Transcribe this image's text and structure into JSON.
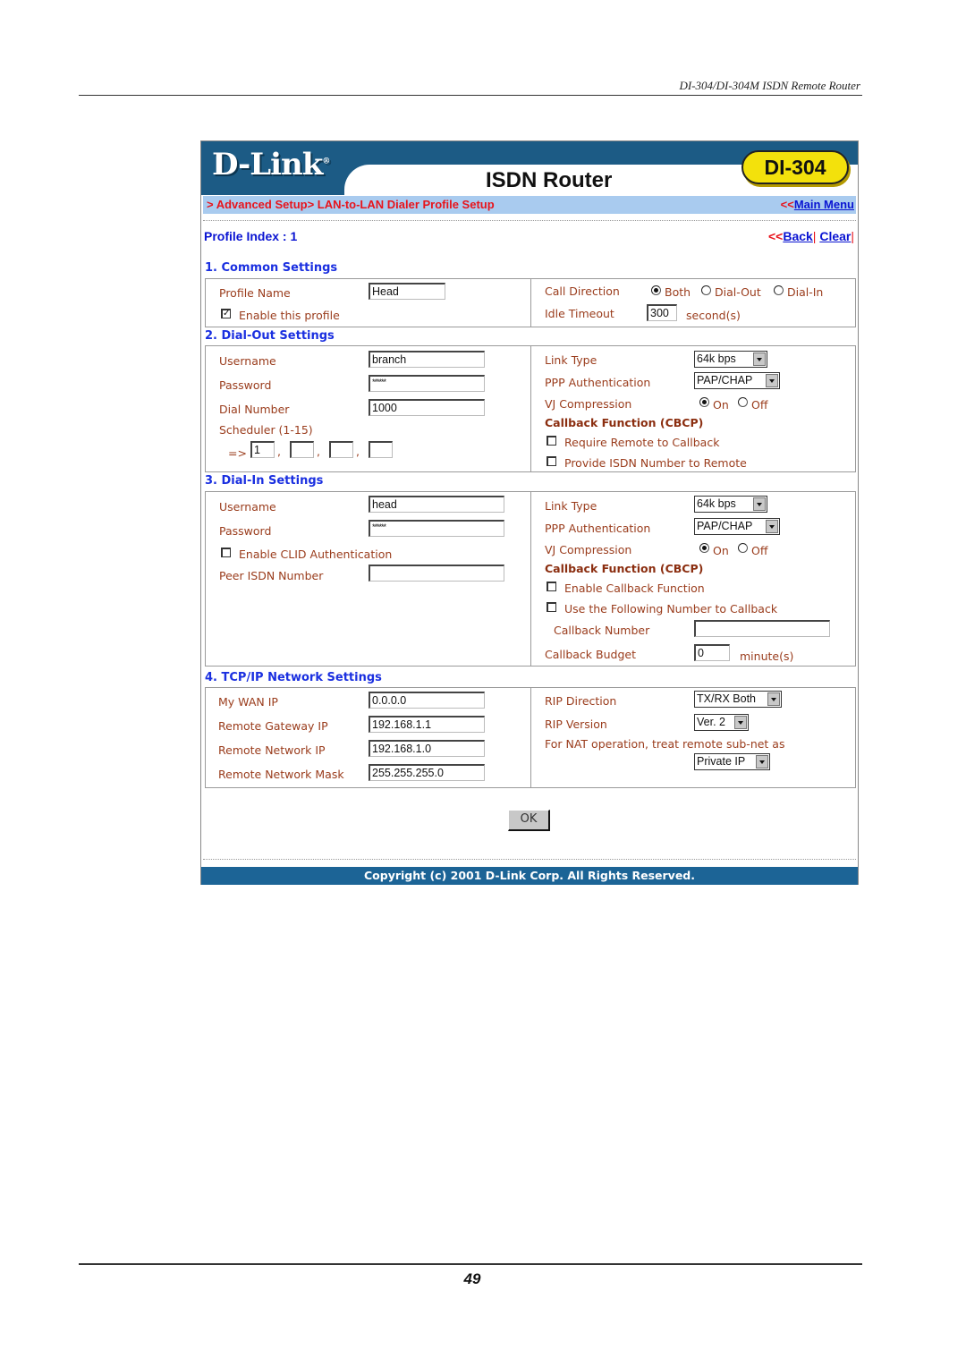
{
  "document": {
    "header_text": "DI-304/DI-304M ISDN Remote Router",
    "page_number": "49"
  },
  "banner": {
    "logo": "D-Link",
    "logo_mark": "®",
    "product_title": "ISDN Router",
    "model": "DI-304"
  },
  "nav": {
    "breadcrumb": "> Advanced Setup> LAN-to-LAN Dialer Profile Setup",
    "main_menu_arrow": "<<",
    "main_menu_label": "Main Menu"
  },
  "profile": {
    "index_label": "Profile Index : 1",
    "back_arrow": "<<",
    "back_label": "Back",
    "separator": "|",
    "clear_label": "Clear"
  },
  "common": {
    "title": "1. Common Settings",
    "profile_name_label": "Profile Name",
    "profile_name_value": "Head",
    "enable_profile_label": "Enable this profile",
    "enable_profile_checked": true,
    "call_direction_label": "Call Direction",
    "call_direction_options": [
      "Both",
      "Dial-Out",
      "Dial-In"
    ],
    "call_direction_selected": "Both",
    "idle_timeout_label": "Idle Timeout",
    "idle_timeout_value": "300",
    "idle_timeout_unit": "second(s)"
  },
  "dial_out": {
    "title": "2. Dial-Out Settings",
    "username_label": "Username",
    "username_value": "branch",
    "password_label": "Password",
    "password_value": "******",
    "dial_number_label": "Dial Number",
    "dial_number_value": "1000",
    "scheduler_label": "Scheduler (1-15)",
    "scheduler_arrow": "=>",
    "scheduler_values": [
      "1",
      "",
      "",
      ""
    ],
    "scheduler_sep": ",",
    "link_type_label": "Link Type",
    "link_type_value": "64k bps",
    "ppp_auth_label": "PPP Authentication",
    "ppp_auth_value": "PAP/CHAP",
    "vj_label": "VJ Compression",
    "vj_on": "On",
    "vj_off": "Off",
    "vj_selected": "On",
    "callback_title": "Callback Function (CBCP)",
    "require_callback_label": "Require Remote to Callback",
    "require_callback_checked": false,
    "provide_isdn_label": "Provide ISDN Number to Remote",
    "provide_isdn_checked": false
  },
  "dial_in": {
    "title": "3. Dial-In Settings",
    "username_label": "Username",
    "username_value": "head",
    "password_label": "Password",
    "password_value": "******",
    "clid_label": "Enable CLID Authentication",
    "clid_checked": false,
    "peer_isdn_label": "Peer ISDN Number",
    "peer_isdn_value": "",
    "link_type_label": "Link Type",
    "link_type_value": "64k bps",
    "ppp_auth_label": "PPP Authentication",
    "ppp_auth_value": "PAP/CHAP",
    "vj_label": "VJ Compression",
    "vj_on": "On",
    "vj_off": "Off",
    "vj_selected": "On",
    "callback_title": "Callback Function (CBCP)",
    "enable_callback_label": "Enable Callback Function",
    "enable_callback_checked": false,
    "use_number_label": "Use the Following Number to Callback",
    "use_number_checked": false,
    "callback_number_label": "Callback Number",
    "callback_number_value": "",
    "callback_budget_label": "Callback Budget",
    "callback_budget_value": "0",
    "callback_budget_unit": "minute(s)"
  },
  "tcpip": {
    "title": "4. TCP/IP Network Settings",
    "wan_ip_label": "My WAN IP",
    "wan_ip_value": "0.0.0.0",
    "gateway_label": "Remote Gateway IP",
    "gateway_value": "192.168.1.1",
    "network_ip_label": "Remote Network IP",
    "network_ip_value": "192.168.1.0",
    "mask_label": "Remote Network Mask",
    "mask_value": "255.255.255.0",
    "rip_direction_label": "RIP Direction",
    "rip_direction_value": "TX/RX Both",
    "rip_version_label": "RIP Version",
    "rip_version_value": "Ver. 2",
    "nat_label": "For NAT operation, treat remote sub-net as",
    "nat_value": "Private IP"
  },
  "actions": {
    "ok_label": "OK"
  },
  "footer": {
    "copyright": "Copyright (c) 2001 D-Link Corp. All Rights Reserved."
  }
}
